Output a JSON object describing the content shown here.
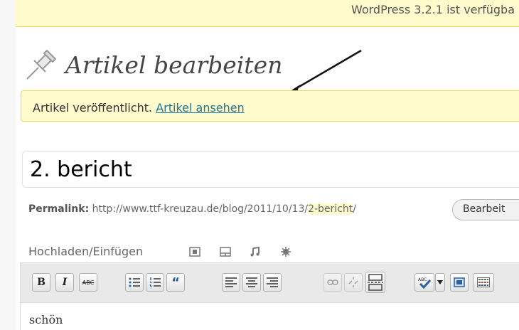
{
  "update_nag": {
    "text": "WordPress 3.2.1 ist verfügba"
  },
  "page": {
    "title": "Artikel bearbeiten"
  },
  "notice": {
    "text": "Artikel veröffentlicht.",
    "link": "Artikel ansehen"
  },
  "post": {
    "title": "2. bericht",
    "permalink_label": "Permalink:",
    "permalink_base": "http://www.ttf-kreuzau.de/blog/2011/10/13/",
    "permalink_slug": "2-bericht",
    "permalink_end": "/",
    "edit_button": "Bearbeit"
  },
  "media": {
    "label": "Hochladen/Einfügen",
    "icons": [
      "image-upload-icon",
      "gallery-upload-icon",
      "audio-upload-icon",
      "media-upload-icon"
    ]
  },
  "toolbar": {
    "bold": "B",
    "italic": "I",
    "strike": "ABC",
    "quote": "“",
    "icons": [
      "bold-icon",
      "italic-icon",
      "strikethrough-icon",
      "bullet-list-icon",
      "numbered-list-icon",
      "blockquote-icon",
      "align-left-icon",
      "align-center-icon",
      "align-right-icon",
      "link-icon",
      "unlink-icon",
      "more-tag-icon",
      "spellcheck-icon",
      "spellcheck-dropdown-icon",
      "fullscreen-icon",
      "kitchen-sink-icon"
    ]
  },
  "editor": {
    "content": "schön"
  },
  "colors": {
    "notice_bg": "#fffbcc",
    "notice_border": "#e6db55",
    "link": "#21759b"
  }
}
